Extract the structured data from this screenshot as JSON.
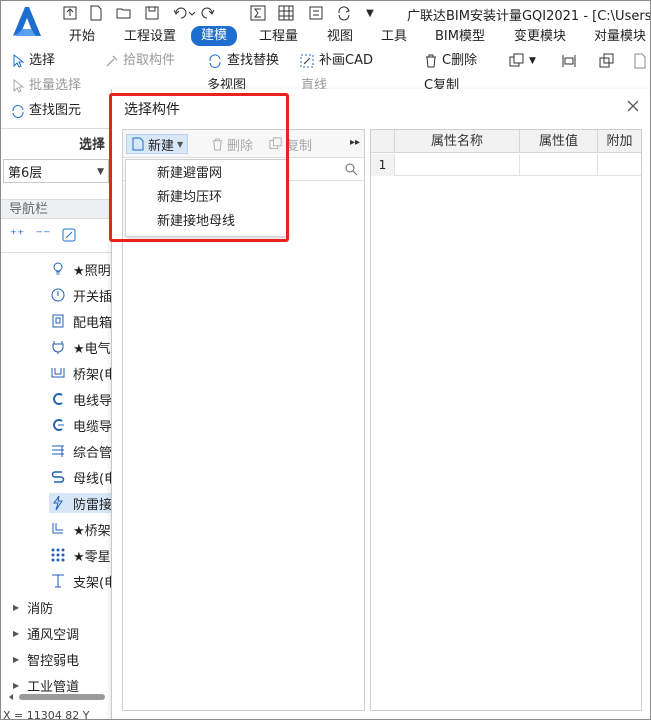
{
  "window": {
    "title": "广联达BIM安装计量GQI2021 - [C:\\Users",
    "logo_icon": "glodon-a-logo"
  },
  "quick_access": [
    "save-icon",
    "new-icon",
    "open-icon",
    "save-disk-icon",
    "undo-icon",
    "redo-icon",
    "sum-icon",
    "grid-icon",
    "layer-icon",
    "refresh-icon"
  ],
  "menu": {
    "items": [
      "开始",
      "工程设置",
      "建模",
      "工程量",
      "视图",
      "工具",
      "BIM模型",
      "变更模块",
      "对量模块"
    ],
    "active": "建模",
    "accent": "#1e6ecf"
  },
  "ribbon": {
    "select": "选择",
    "batch_select": "批量选择",
    "find_element": "查找图元",
    "pick_component": "拾取构件",
    "find_replace": "查找替换",
    "patch_cad": "补画CAD",
    "c_delete": "C删除",
    "multi_view": "多视图",
    "line": "直线",
    "c_copy": "C复制",
    "group_label": "选择"
  },
  "left_panel": {
    "floor": "第6层",
    "nav_title": "导航栏",
    "nav_items": [
      {
        "label": "★照明",
        "icon": "bulb-icon"
      },
      {
        "label": "开关插",
        "icon": "switch-icon"
      },
      {
        "label": "配电箱",
        "icon": "panel-box-icon"
      },
      {
        "label": "★电气",
        "icon": "plug-icon"
      },
      {
        "label": "桥架(电",
        "icon": "tray-icon"
      },
      {
        "label": "电线导",
        "icon": "wire-conduit-icon"
      },
      {
        "label": "电缆导",
        "icon": "cable-conduit-icon"
      },
      {
        "label": "综合管",
        "icon": "integrated-pipe-icon"
      },
      {
        "label": "母线(电",
        "icon": "busbar-icon"
      },
      {
        "label": "防雷接",
        "icon": "lightning-icon"
      },
      {
        "label": "★桥架",
        "icon": "tray-fitting-icon"
      },
      {
        "label": "★零星",
        "icon": "dots-grid-icon"
      },
      {
        "label": "支架(电",
        "icon": "bracket-icon"
      }
    ],
    "selected_index": 9,
    "groups": [
      "消防",
      "通风空调",
      "智控弱电",
      "工业管道"
    ],
    "status": "X = 11304 82 Y"
  },
  "dialog": {
    "title": "选择构件",
    "toolbar": {
      "new": "新建",
      "delete": "删除",
      "copy": "复制"
    },
    "new_menu": [
      "新建避雷网",
      "新建均压环",
      "新建接地母线"
    ],
    "table": {
      "headers": [
        "",
        "属性名称",
        "属性值",
        "附加"
      ],
      "rows": [
        [
          "1",
          "",
          "",
          ""
        ]
      ]
    }
  },
  "highlight_color": "#e8231e"
}
